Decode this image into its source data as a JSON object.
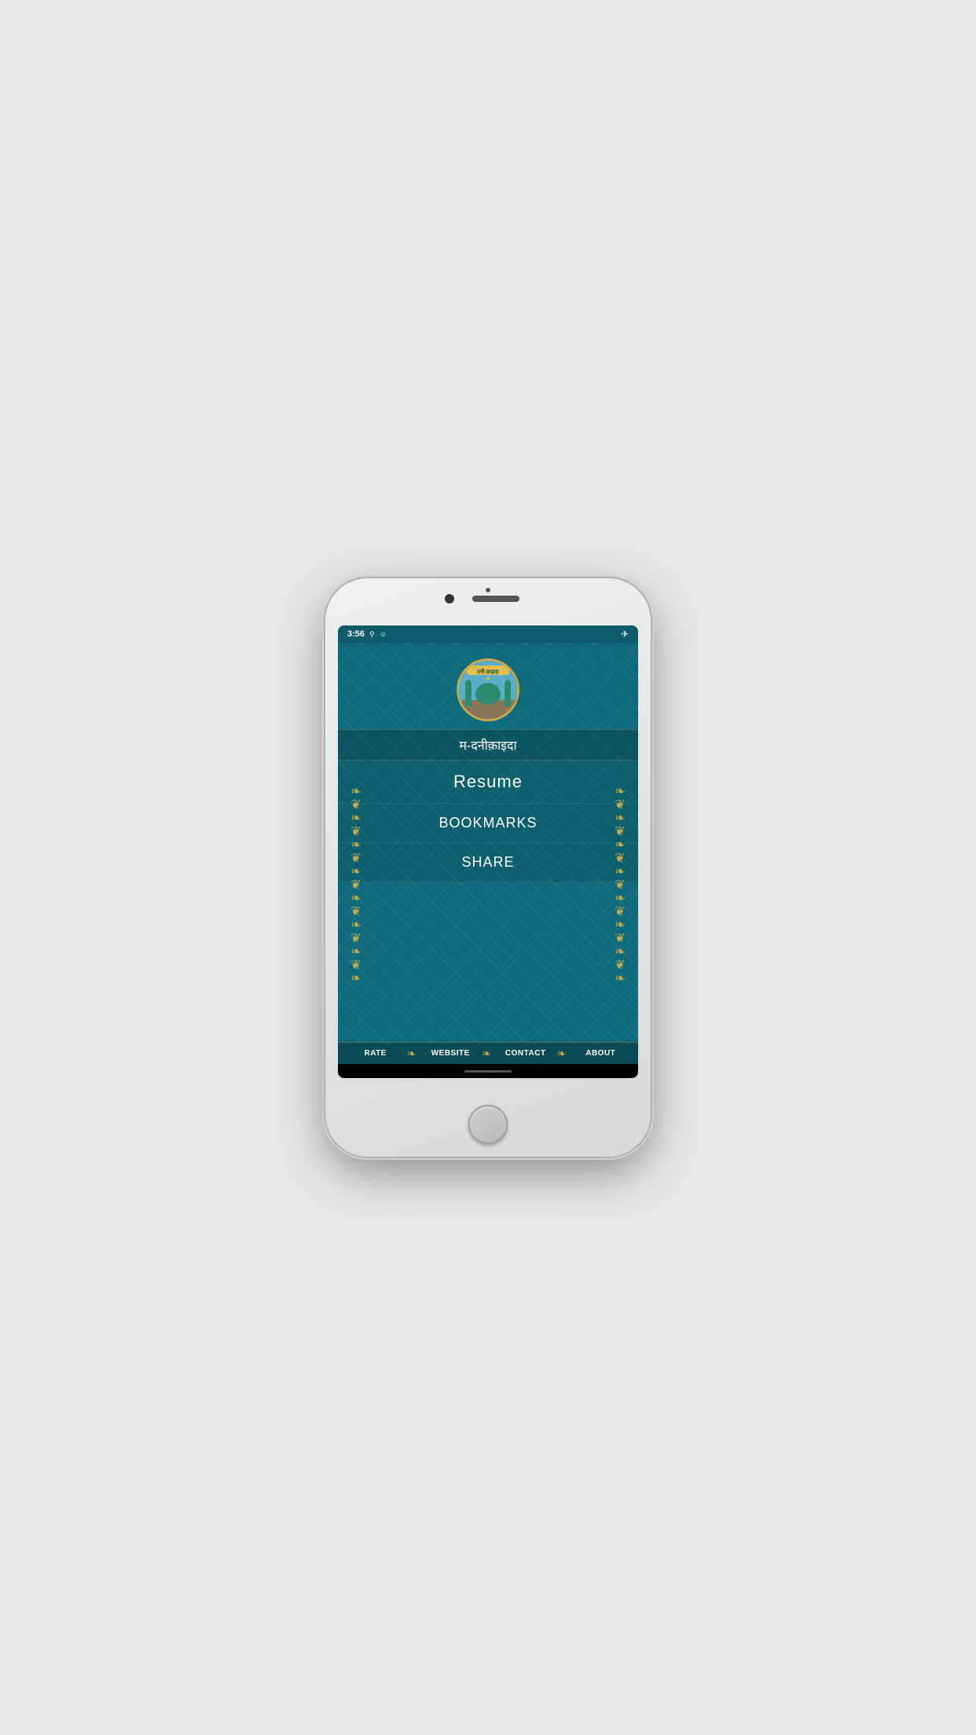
{
  "phone": {
    "status_bar": {
      "time": "3:56",
      "icons_left": [
        "signal",
        "wifi"
      ],
      "airplane_mode": "✈"
    }
  },
  "app": {
    "title": "म-दनीक़ाइदा",
    "logo_alt": "Dini Qaida App Logo",
    "menu": {
      "resume_label": "Resume",
      "bookmarks_label": "BOOKMARKS",
      "share_label": "SHARE"
    },
    "bottom_tabs": [
      {
        "label": "RATE",
        "id": "rate"
      },
      {
        "label": "WEBSITE",
        "id": "website"
      },
      {
        "label": "CONTACT",
        "id": "contact"
      },
      {
        "label": "ABOUT",
        "id": "about"
      }
    ]
  }
}
